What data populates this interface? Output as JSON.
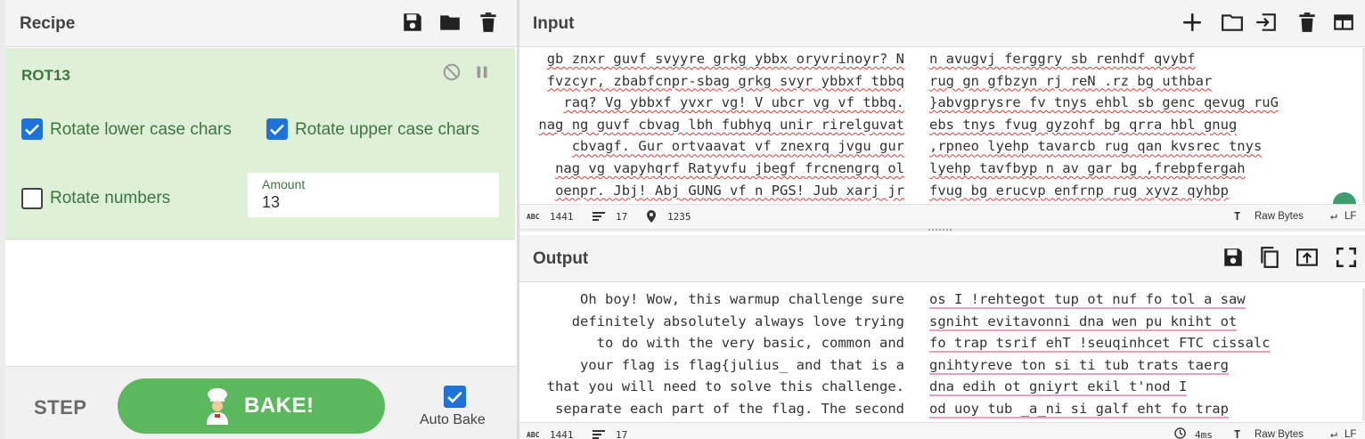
{
  "recipe": {
    "title": "Recipe",
    "header_icons": [
      "save-icon",
      "folder-icon",
      "trash-icon"
    ],
    "operation": {
      "name": "ROT13",
      "rotate_lower_label": "Rotate lower case chars",
      "rotate_lower_checked": true,
      "rotate_upper_label": "Rotate upper case chars",
      "rotate_upper_checked": true,
      "rotate_numbers_label": "Rotate numbers",
      "rotate_numbers_checked": false,
      "amount_label": "Amount",
      "amount_value": "13"
    },
    "step_label": "STEP",
    "bake_label": "BAKE!",
    "auto_bake_label": "Auto Bake",
    "auto_bake_checked": true
  },
  "input": {
    "title": "Input",
    "header_icons": [
      "plus-icon",
      "open-folder-icon",
      "import-icon",
      "trash-icon",
      "layout-icon"
    ],
    "left_lines": [
      "gb znxr guvf svyyre grkg ybbx oryvrinoyr? N",
      "fvzcyr, zbabfcnpr-sbag grkg svyr ybbxf tbbq",
      "raq? Vg ybbxf yvxr vg! V ubcr vg vf tbbq.",
      "nag ng guvf cbvag lbh fubhyq unir rirelguvat",
      "cbvagf. Gur ortvaavat vf znexrq jvgu gur",
      "nag vg vapyhqrf Ratyvfu jbegf frcnengrq ol",
      "oenpr. Jbj! Abj GUNG vf n PGS! Jub xarj jr"
    ],
    "right_lines": [
      "n avugvj ferggry sb renhdf qvybf",
      "rug gn gfbzyn rj reN .rz bg uthbar",
      "}abvgprysre fv tnys ehbl sb genc qevug ruG",
      "ebs tnys fvug gyzohf bg qrra hbl gnug",
      ",rpneo lyehp tavarcb rug qan kvsrec tnys",
      "lyehp tavfbyp n av gar bg ,frebpfergah",
      "fvug bg erucvp enfrnp rug xyvz qyhbp"
    ],
    "stats": {
      "chars": "1441",
      "lines": "17",
      "position": "1235"
    },
    "raw_bytes_label": "Raw Bytes",
    "eol_label": "LF"
  },
  "output": {
    "title": "Output",
    "header_icons": [
      "save-icon",
      "copy-icon",
      "replace-input-icon",
      "fullscreen-icon"
    ],
    "left_lines": [
      "Oh boy! Wow, this warmup challenge sure",
      "definitely absolutely always love trying",
      "to do with the very basic, common and",
      "your flag is flag{julius_ and that is a",
      "that you will need to solve this challenge.",
      "separate each part of the flag. The second"
    ],
    "right_lines": [
      "os I !rehtegot tup ot nuf fo tol a saw",
      "sgniht evitavonni dna wen pu kniht ot",
      "fo trap tsrif ehT !seuqinhcet FTC cissalc",
      "gnihtyreve ton si ti tub trats taerg",
      "dna edih ot gniyrt ekil t'nod I",
      "od uoy tub _a_ni si galf eht fo trap"
    ],
    "stats": {
      "chars": "1441",
      "lines": "17",
      "time": "4ms"
    },
    "raw_bytes_label": "Raw Bytes",
    "eol_label": "LF"
  },
  "colors": {
    "accent_green": "#5cb85c",
    "op_bg": "#dff0d8",
    "op_text": "#3c763d",
    "checkbox_blue": "#1f73d8"
  }
}
